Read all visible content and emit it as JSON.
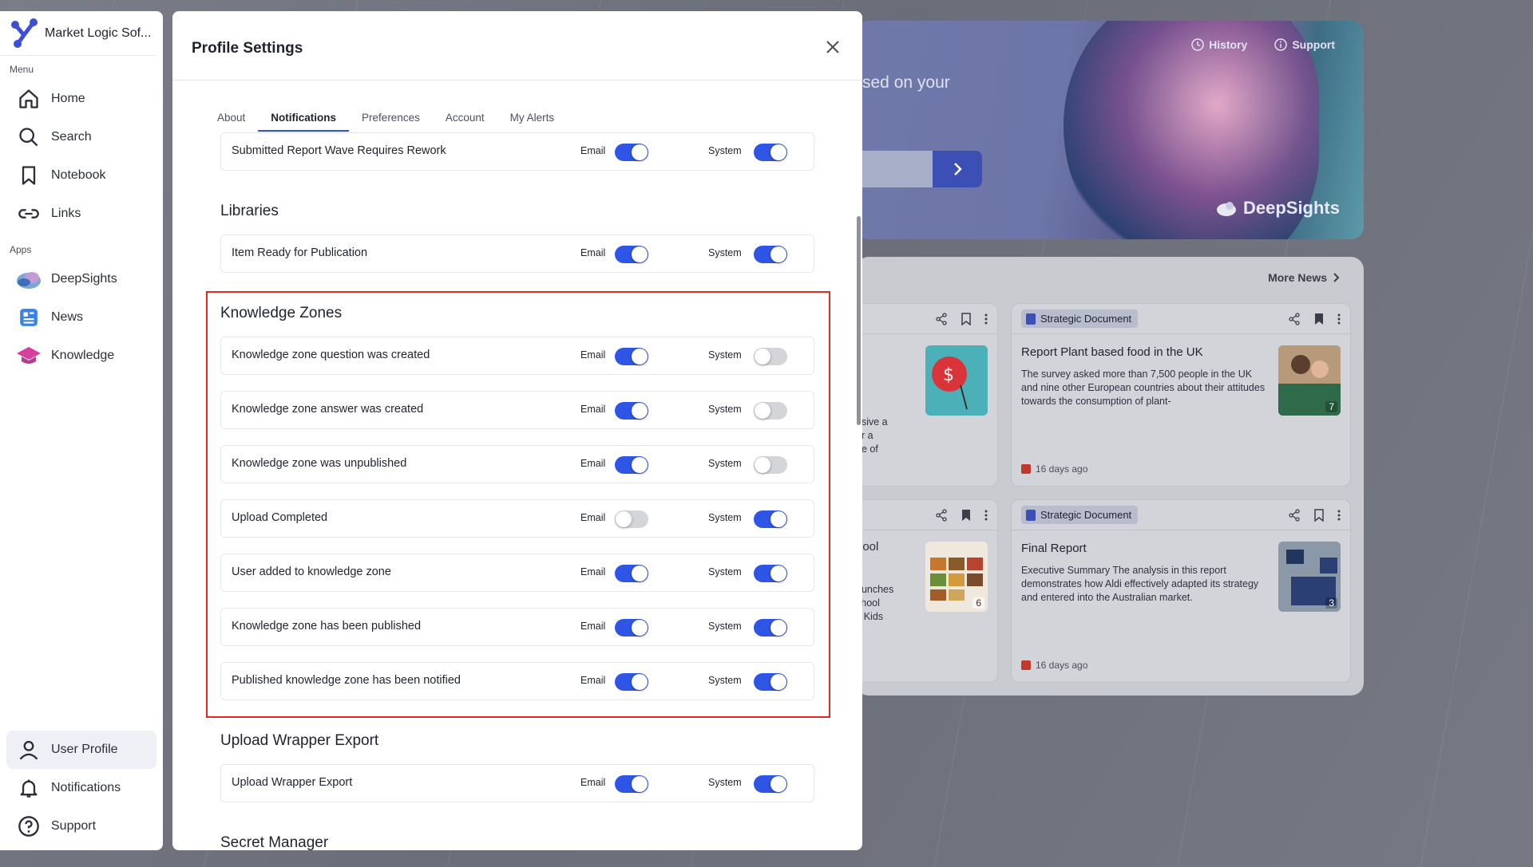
{
  "sidebar": {
    "brand": "Market Logic Sof...",
    "menu_label": "Menu",
    "menu": [
      {
        "label": "Home",
        "icon": "home-icon"
      },
      {
        "label": "Search",
        "icon": "search-icon"
      },
      {
        "label": "Notebook",
        "icon": "bookmark-icon"
      },
      {
        "label": "Links",
        "icon": "link-icon"
      }
    ],
    "apps_label": "Apps",
    "apps": [
      {
        "label": "DeepSights",
        "icon": "deepsights-icon"
      },
      {
        "label": "News",
        "icon": "news-icon"
      },
      {
        "label": "Knowledge",
        "icon": "knowledge-icon"
      }
    ],
    "bottom": [
      {
        "label": "User Profile",
        "icon": "user-icon",
        "active": true
      },
      {
        "label": "Notifications",
        "icon": "bell-icon"
      },
      {
        "label": "Support",
        "icon": "help-icon"
      }
    ]
  },
  "hero": {
    "history": "History",
    "support": "Support",
    "partial_text": "sed on your",
    "brand": "DeepSights"
  },
  "news": {
    "more_news": "More News",
    "cards": [
      {
        "badge": "Strategic Document",
        "title": "Report Plant based food in the UK",
        "body": "The survey asked more than 7,500 people in the UK and nine other European countries about their attitudes towards the consumption of plant-",
        "date": "16 days ago",
        "views": "7"
      },
      {
        "badge": "Strategic Document",
        "title": "Final Report",
        "body": "Executive Summary The analysis in this report demonstrates how Aldi effectively adapted its strategy and entered into the Australian market.",
        "date": "16 days ago",
        "views": "3"
      }
    ],
    "left_fragments": {
      "top": [
        "nsive a",
        "er a",
        "ne of"
      ],
      "bottom_title": "hool",
      "bottom": [
        "Lunches",
        "chool",
        "y Kids"
      ],
      "bottom_views": "6"
    }
  },
  "modal": {
    "title": "Profile Settings",
    "tabs": [
      "About",
      "Notifications",
      "Preferences",
      "Account",
      "My Alerts"
    ],
    "active_tab": "Notifications",
    "email_label": "Email",
    "system_label": "System",
    "sections": {
      "top_row": {
        "label": "Submitted Report Wave Requires Rework",
        "email": true,
        "system": true
      },
      "libraries": {
        "title": "Libraries",
        "rows": [
          {
            "label": "Item Ready for Publication",
            "email": true,
            "system": true
          }
        ]
      },
      "knowledge_zones": {
        "title": "Knowledge Zones",
        "rows": [
          {
            "label": "Knowledge zone question was created",
            "email": true,
            "system": false
          },
          {
            "label": "Knowledge zone answer was created",
            "email": true,
            "system": false
          },
          {
            "label": "Knowledge zone was unpublished",
            "email": true,
            "system": false
          },
          {
            "label": "Upload Completed",
            "email": false,
            "system": true
          },
          {
            "label": "User added to knowledge zone",
            "email": true,
            "system": true
          },
          {
            "label": "Knowledge zone has been published",
            "email": true,
            "system": true
          },
          {
            "label": "Published knowledge zone has been notified",
            "email": true,
            "system": true
          }
        ]
      },
      "upload_wrapper": {
        "title": "Upload Wrapper Export",
        "rows": [
          {
            "label": "Upload Wrapper Export",
            "email": true,
            "system": true
          }
        ]
      },
      "secret_manager": {
        "title": "Secret Manager"
      }
    }
  },
  "colors": {
    "accent": "#2f55e6",
    "highlight": "#e12b20",
    "toggle_off": "#d3d5db"
  }
}
